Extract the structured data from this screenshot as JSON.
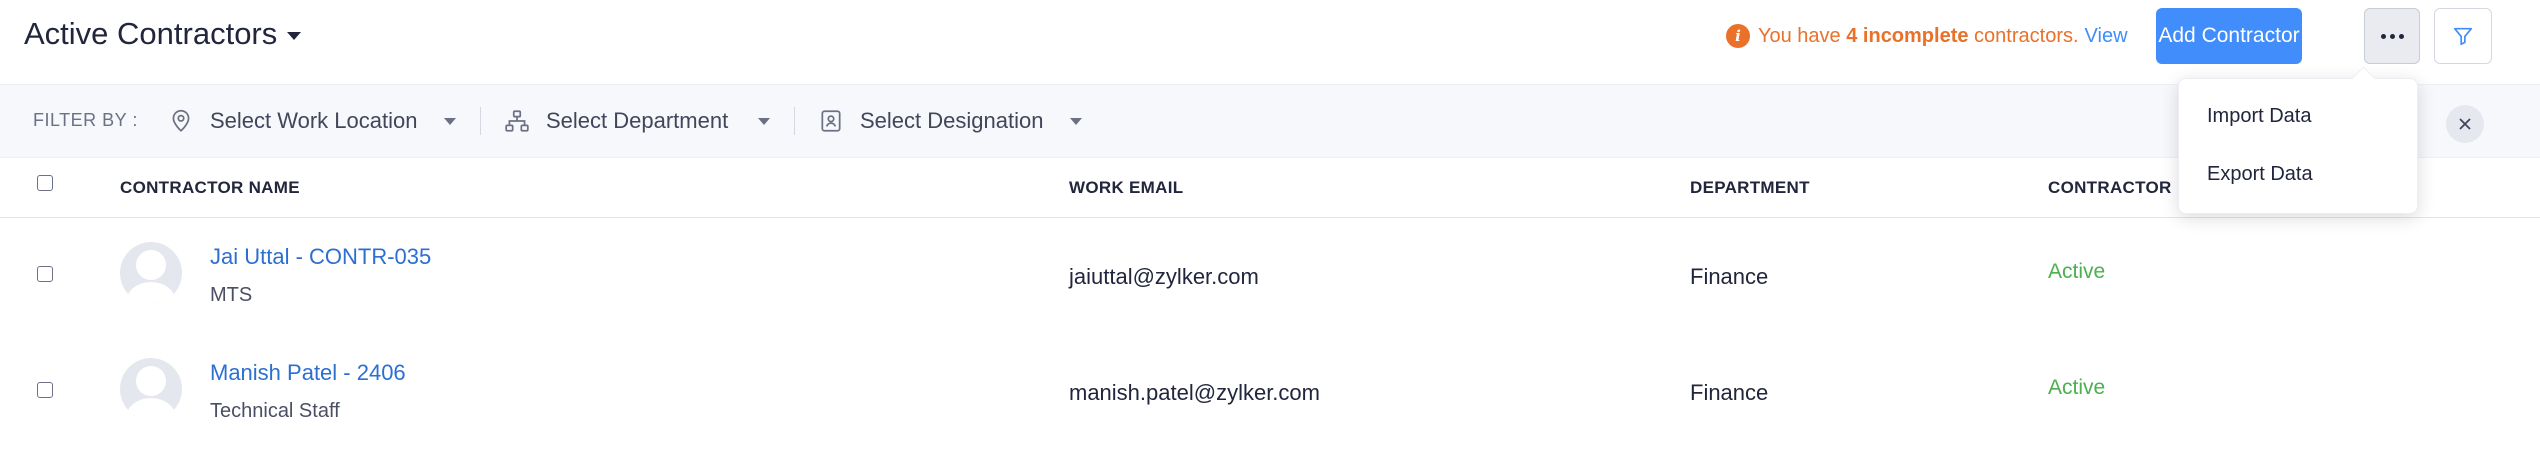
{
  "header": {
    "title": "Active Contractors",
    "notice": {
      "prefix": "You have ",
      "count": "4 incomplete",
      "suffix": " contractors.",
      "link": "View"
    },
    "add_button": "Add Contractor"
  },
  "filters": {
    "label": "FILTER BY :",
    "work_location": "Select Work Location",
    "department": "Select Department",
    "designation": "Select Designation"
  },
  "table": {
    "columns": [
      "CONTRACTOR NAME",
      "WORK EMAIL",
      "DEPARTMENT",
      "CONTRACTOR"
    ],
    "rows": [
      {
        "name": "Jai Uttal - CONTR-035",
        "designation": "MTS",
        "email": "jaiuttal@zylker.com",
        "department": "Finance",
        "status": "Active"
      },
      {
        "name": "Manish Patel - 2406",
        "designation": "Technical Staff",
        "email": "manish.patel@zylker.com",
        "department": "Finance",
        "status": "Active"
      }
    ]
  },
  "more_menu": {
    "items": [
      "Import Data",
      "Export Data"
    ]
  },
  "colors": {
    "accent": "#408dfb",
    "warning": "#e9712a",
    "status_active": "#4caf50"
  },
  "icons": [
    "caret-down-icon",
    "info-icon",
    "more-icon",
    "filter-icon",
    "location-pin-icon",
    "department-icon",
    "designation-icon",
    "close-icon",
    "avatar-icon"
  ]
}
